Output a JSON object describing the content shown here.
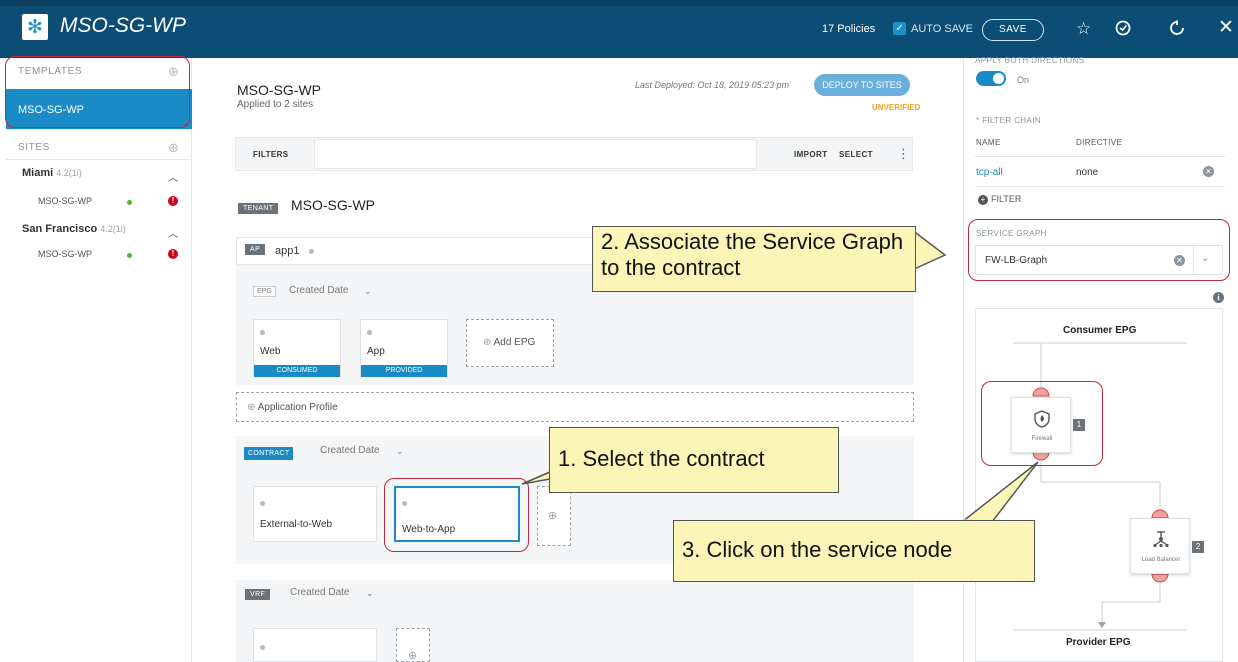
{
  "header": {
    "title": "MSO-SG-WP",
    "policies": "17 Policies",
    "autosave": "AUTO SAVE",
    "save": "SAVE"
  },
  "sidebar": {
    "templates_label": "TEMPLATES",
    "template_active": "MSO-SG-WP",
    "sites_label": "SITES",
    "sites": [
      {
        "name": "Miami",
        "version": "4.2(1i)",
        "item": "MSO-SG-WP"
      },
      {
        "name": "San Francisco",
        "version": "4.2(1i)",
        "item": "MSO-SG-WP"
      }
    ]
  },
  "main": {
    "title": "MSO-SG-WP",
    "subtitle": "Applied to 2 sites",
    "last_deployed": "Last Deployed: Oct 18, 2019 05:23 pm",
    "deploy_button": "DEPLOY TO SITES",
    "status": "UNVERIFIED",
    "filters_label": "FILTERS",
    "import_label": "IMPORT",
    "select_label": "SELECT",
    "tenant_tag": "TENANT",
    "tenant_name": "MSO-SG-WP",
    "ap": {
      "tag": "AP",
      "name": "app1",
      "epg_tag": "EPG",
      "sort": "Created Date",
      "epgs": [
        {
          "name": "Web",
          "footer": "CONSUMED"
        },
        {
          "name": "App",
          "footer": "PROVIDED"
        }
      ],
      "add_epg": "Add EPG",
      "app_profile": "Application Profile"
    },
    "contract": {
      "tag": "CONTRACT",
      "sort": "Created Date",
      "items": [
        "External-to-Web",
        "Web-to-App"
      ]
    },
    "vrf": {
      "tag": "VRF",
      "sort": "Created Date"
    }
  },
  "right": {
    "apply_both": "APPLY BOTH DIRECTIONS",
    "toggle_label": "On",
    "filter_chain": "* FILTER CHAIN",
    "col_name": "NAME",
    "col_directive": "DIRECTIVE",
    "filter_name": "tcp-all",
    "filter_directive": "none",
    "add_filter": "FILTER",
    "service_graph_label": "SERVICE GRAPH",
    "service_graph_value": "FW-LB-Graph",
    "consumer": "Consumer EPG",
    "provider": "Provider EPG",
    "nodes": [
      {
        "caption": "Firewall",
        "num": "1"
      },
      {
        "caption": "Load Balancer",
        "num": "2"
      }
    ]
  },
  "annotations": {
    "note1": "1. Select the contract",
    "note2": "2. Associate the Service Graph to the contract",
    "note3": "3. Click on the service node"
  },
  "colors": {
    "header_bg": "#0b4d74",
    "accent": "#1b8bc6",
    "callout_border": "#c0283a",
    "note_bg": "#fcf5b8"
  }
}
